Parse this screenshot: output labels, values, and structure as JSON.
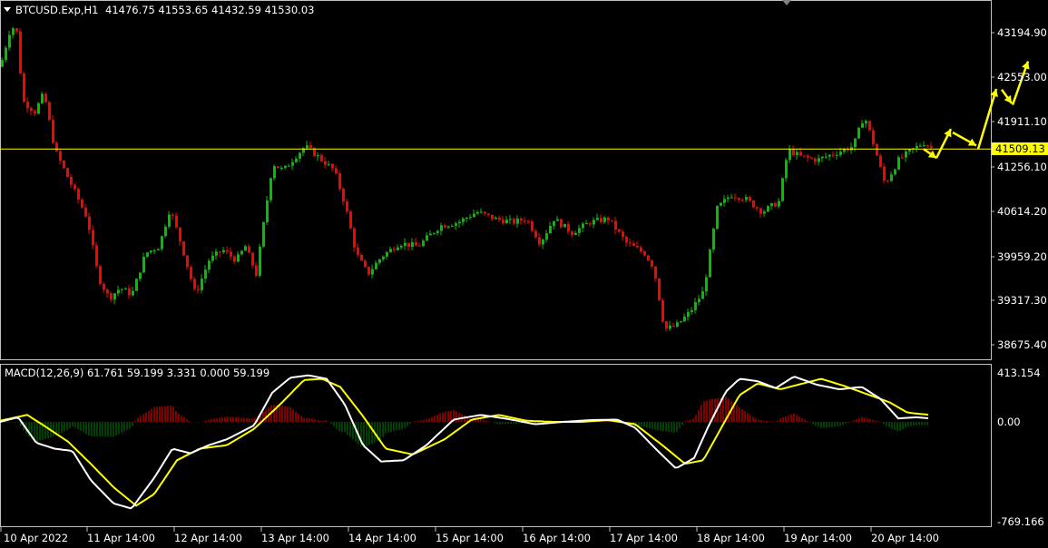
{
  "header": {
    "symbol": "BTCUSD.Exp,H1",
    "ohlc": "41476.75 41553.65 41432.59 41530.03"
  },
  "price_axis": {
    "labels": [
      "43194.90",
      "42553.00",
      "41911.10",
      "41256.10",
      "40614.20",
      "39959.20",
      "39317.30",
      "38675.40"
    ],
    "current_price": "41509.13"
  },
  "macd": {
    "header": "MACD(12,26,9) 61.761 59.199 3.331 0.000 59.199",
    "labels": [
      "413.154",
      "0.00",
      "-769.166"
    ]
  },
  "time_axis": {
    "labels": [
      "10 Apr 2022",
      "11 Apr 14:00",
      "12 Apr 14:00",
      "13 Apr 14:00",
      "14 Apr 14:00",
      "15 Apr 14:00",
      "16 Apr 14:00",
      "17 Apr 14:00",
      "18 Apr 14:00",
      "19 Apr 14:00",
      "20 Apr 14:00"
    ]
  },
  "colors": {
    "background": "#000000",
    "bull": "#00c000",
    "bear": "#ff0000",
    "level_line": "#ffff00",
    "macd_line": "#ffffff",
    "signal_line": "#ffff00",
    "hist_pos": "#ff0000",
    "hist_neg": "#008000",
    "border": "#c0c0c0"
  },
  "chart_data": {
    "type": "candlestick",
    "title": "BTCUSD.Exp,H1",
    "timeframe": "H1",
    "ylim": [
      38500,
      43500
    ],
    "level_line": 41509.13,
    "path": [
      {
        "t": 0,
        "p": 42700
      },
      {
        "t": 12,
        "p": 43300
      },
      {
        "t": 18,
        "p": 43200
      },
      {
        "t": 25,
        "p": 42200
      },
      {
        "t": 38,
        "p": 42050
      },
      {
        "t": 48,
        "p": 42320
      },
      {
        "t": 60,
        "p": 41500
      },
      {
        "t": 78,
        "p": 41000
      },
      {
        "t": 96,
        "p": 40500
      },
      {
        "t": 108,
        "p": 39650
      },
      {
        "t": 120,
        "p": 39350
      },
      {
        "t": 132,
        "p": 39500
      },
      {
        "t": 145,
        "p": 39400
      },
      {
        "t": 160,
        "p": 40000
      },
      {
        "t": 175,
        "p": 40100
      },
      {
        "t": 187,
        "p": 40650
      },
      {
        "t": 200,
        "p": 40100
      },
      {
        "t": 215,
        "p": 39400
      },
      {
        "t": 230,
        "p": 39900
      },
      {
        "t": 245,
        "p": 40050
      },
      {
        "t": 260,
        "p": 39900
      },
      {
        "t": 270,
        "p": 40100
      },
      {
        "t": 282,
        "p": 39700
      },
      {
        "t": 292,
        "p": 40600
      },
      {
        "t": 300,
        "p": 41300
      },
      {
        "t": 312,
        "p": 41200
      },
      {
        "t": 325,
        "p": 41400
      },
      {
        "t": 336,
        "p": 41550
      },
      {
        "t": 350,
        "p": 41400
      },
      {
        "t": 368,
        "p": 41200
      },
      {
        "t": 380,
        "p": 40700
      },
      {
        "t": 392,
        "p": 40000
      },
      {
        "t": 405,
        "p": 39700
      },
      {
        "t": 420,
        "p": 39950
      },
      {
        "t": 440,
        "p": 40150
      },
      {
        "t": 460,
        "p": 40100
      },
      {
        "t": 485,
        "p": 40400
      },
      {
        "t": 505,
        "p": 40450
      },
      {
        "t": 525,
        "p": 40600
      },
      {
        "t": 545,
        "p": 40500
      },
      {
        "t": 565,
        "p": 40450
      },
      {
        "t": 580,
        "p": 40500
      },
      {
        "t": 595,
        "p": 40150
      },
      {
        "t": 610,
        "p": 40500
      },
      {
        "t": 630,
        "p": 40300
      },
      {
        "t": 650,
        "p": 40450
      },
      {
        "t": 670,
        "p": 40500
      },
      {
        "t": 690,
        "p": 40150
      },
      {
        "t": 710,
        "p": 40000
      },
      {
        "t": 720,
        "p": 39800
      },
      {
        "t": 732,
        "p": 38900
      },
      {
        "t": 745,
        "p": 38950
      },
      {
        "t": 760,
        "p": 39150
      },
      {
        "t": 775,
        "p": 39450
      },
      {
        "t": 790,
        "p": 40650
      },
      {
        "t": 805,
        "p": 40850
      },
      {
        "t": 820,
        "p": 40800
      },
      {
        "t": 840,
        "p": 40600
      },
      {
        "t": 858,
        "p": 40750
      },
      {
        "t": 868,
        "p": 41500
      },
      {
        "t": 882,
        "p": 41400
      },
      {
        "t": 900,
        "p": 41350
      },
      {
        "t": 920,
        "p": 41450
      },
      {
        "t": 940,
        "p": 41550
      },
      {
        "t": 952,
        "p": 42000
      },
      {
        "t": 962,
        "p": 41600
      },
      {
        "t": 975,
        "p": 41000
      },
      {
        "t": 990,
        "p": 41350
      },
      {
        "t": 1005,
        "p": 41500
      },
      {
        "t": 1018,
        "p": 41600
      },
      {
        "t": 1028,
        "p": 41509
      }
    ],
    "forecast_arrows": [
      [
        {
          "p": 41509
        },
        {
          "p": 41380
        }
      ],
      [
        {
          "p": 41380
        },
        {
          "p": 41800
        }
      ],
      [
        {
          "p": 41750
        },
        {
          "p": 41560
        }
      ],
      [
        {
          "p": 41509
        },
        {
          "p": 42380
        }
      ],
      [
        {
          "p": 42370
        },
        {
          "p": 42170
        }
      ],
      [
        {
          "p": 42150
        },
        {
          "p": 42780
        }
      ]
    ],
    "macd_ylim": [
      -790,
      440
    ],
    "macd_line": [
      [
        0,
        0
      ],
      [
        20,
        40
      ],
      [
        40,
        -180
      ],
      [
        60,
        -230
      ],
      [
        80,
        -250
      ],
      [
        100,
        -500
      ],
      [
        125,
        -700
      ],
      [
        145,
        -745
      ],
      [
        170,
        -480
      ],
      [
        190,
        -230
      ],
      [
        210,
        -270
      ],
      [
        230,
        -200
      ],
      [
        250,
        -150
      ],
      [
        280,
        -30
      ],
      [
        300,
        250
      ],
      [
        320,
        380
      ],
      [
        340,
        400
      ],
      [
        360,
        370
      ],
      [
        380,
        150
      ],
      [
        400,
        -200
      ],
      [
        420,
        -340
      ],
      [
        445,
        -330
      ],
      [
        470,
        -200
      ],
      [
        500,
        20
      ],
      [
        530,
        60
      ],
      [
        560,
        25
      ],
      [
        590,
        -20
      ],
      [
        620,
        0
      ],
      [
        650,
        15
      ],
      [
        680,
        20
      ],
      [
        700,
        -50
      ],
      [
        725,
        -250
      ],
      [
        745,
        -400
      ],
      [
        765,
        -310
      ],
      [
        780,
        -50
      ],
      [
        800,
        260
      ],
      [
        815,
        370
      ],
      [
        835,
        350
      ],
      [
        855,
        290
      ],
      [
        875,
        390
      ],
      [
        900,
        320
      ],
      [
        925,
        280
      ],
      [
        950,
        300
      ],
      [
        970,
        200
      ],
      [
        990,
        30
      ],
      [
        1010,
        40
      ],
      [
        1025,
        30
      ]
    ],
    "signal_line": [
      [
        0,
        10
      ],
      [
        30,
        60
      ],
      [
        50,
        -40
      ],
      [
        75,
        -170
      ],
      [
        100,
        -360
      ],
      [
        125,
        -560
      ],
      [
        150,
        -720
      ],
      [
        170,
        -620
      ],
      [
        195,
        -330
      ],
      [
        220,
        -230
      ],
      [
        250,
        -200
      ],
      [
        280,
        -60
      ],
      [
        310,
        160
      ],
      [
        335,
        360
      ],
      [
        355,
        370
      ],
      [
        375,
        300
      ],
      [
        400,
        50
      ],
      [
        425,
        -230
      ],
      [
        455,
        -280
      ],
      [
        490,
        -150
      ],
      [
        520,
        20
      ],
      [
        550,
        60
      ],
      [
        580,
        10
      ],
      [
        610,
        0
      ],
      [
        640,
        0
      ],
      [
        670,
        15
      ],
      [
        700,
        -20
      ],
      [
        730,
        -200
      ],
      [
        755,
        -360
      ],
      [
        775,
        -330
      ],
      [
        795,
        -50
      ],
      [
        815,
        230
      ],
      [
        835,
        330
      ],
      [
        860,
        280
      ],
      [
        880,
        320
      ],
      [
        905,
        370
      ],
      [
        930,
        310
      ],
      [
        955,
        240
      ],
      [
        980,
        170
      ],
      [
        1000,
        80
      ],
      [
        1025,
        60
      ]
    ]
  }
}
